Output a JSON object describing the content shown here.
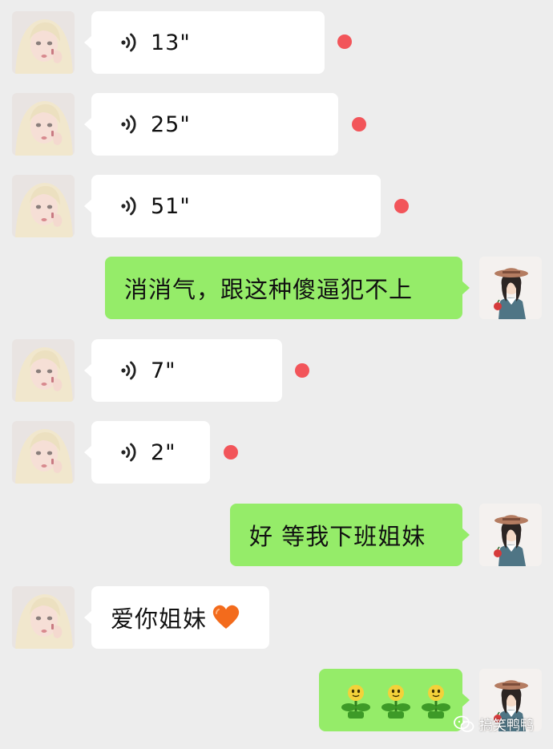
{
  "chat": {
    "messages": [
      {
        "kind": "voice",
        "side": "in",
        "duration": "13\"",
        "unread": true
      },
      {
        "kind": "voice",
        "side": "in",
        "duration": "25\"",
        "unread": true
      },
      {
        "kind": "voice",
        "side": "in",
        "duration": "51\"",
        "unread": true
      },
      {
        "kind": "text",
        "side": "out",
        "text": "消消气，跟这种傻逼犯不上"
      },
      {
        "kind": "voice",
        "side": "in",
        "duration": "7\"",
        "unread": true
      },
      {
        "kind": "voice",
        "side": "in",
        "duration": "2\"",
        "unread": true
      },
      {
        "kind": "text",
        "side": "out",
        "text": "好 等我下班姐妹"
      },
      {
        "kind": "text",
        "side": "in",
        "text": "爱你姐妹",
        "icon": "orange-heart-icon"
      },
      {
        "kind": "stickers",
        "side": "out",
        "count": 3,
        "icon": "sprout-emoji-icon"
      }
    ]
  },
  "watermark": {
    "text": "搞笑鸭鸭",
    "icon": "wechat-official-account-icon"
  },
  "colors": {
    "background": "#ededed",
    "incoming_bubble": "#ffffff",
    "outgoing_bubble": "#95ec69",
    "unread_dot": "#f2555a"
  }
}
